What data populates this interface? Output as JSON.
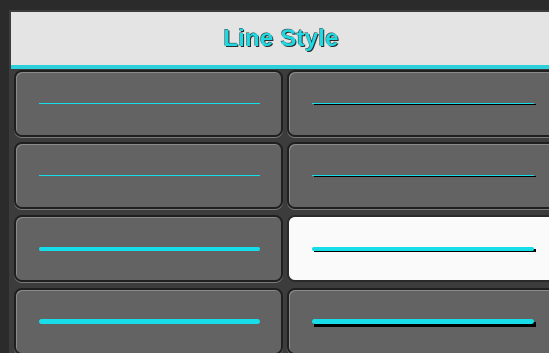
{
  "header": {
    "title": "Line Style"
  },
  "line_styles": [
    {
      "id": "thin",
      "width": 1,
      "shadow": false,
      "selected": false
    },
    {
      "id": "thin-shadow",
      "width": 1,
      "shadow": true,
      "selected": false
    },
    {
      "id": "hairline",
      "width": 1,
      "shadow": false,
      "selected": false
    },
    {
      "id": "hairline-shadow",
      "width": 1,
      "shadow": true,
      "selected": false
    },
    {
      "id": "medium",
      "width": 4,
      "shadow": false,
      "selected": false
    },
    {
      "id": "medium-shadow",
      "width": 4,
      "shadow": true,
      "selected": true
    },
    {
      "id": "thick",
      "width": 5,
      "shadow": false,
      "selected": false
    },
    {
      "id": "thick-shadow",
      "width": 5,
      "shadow": true,
      "selected": false
    }
  ],
  "colors": {
    "accent": "#17dde8",
    "tile": "#636363",
    "tile_selected": "#fafafa",
    "header_bg": "#e4e4e4"
  }
}
